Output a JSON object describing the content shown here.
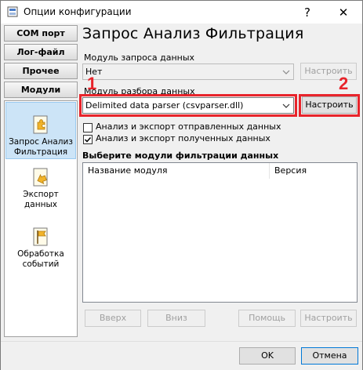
{
  "window": {
    "title": "Опции конфигурации",
    "help_glyph": "?",
    "close_glyph": "✕"
  },
  "nav": {
    "buttons": [
      "COM порт",
      "Лог-файл",
      "Прочее",
      "Модули"
    ]
  },
  "sidebar": {
    "items": [
      {
        "label": "Запрос Анализ Фильтрация",
        "icon": "puzzle-icon",
        "active": true
      },
      {
        "label": "Экспорт данных",
        "icon": "export-icon",
        "active": false
      },
      {
        "label": "Обработка событий",
        "icon": "flag-icon",
        "active": false
      }
    ]
  },
  "main": {
    "header": "Запрос Анализ Фильтрация",
    "query_module": {
      "label": "Модуль запроса данных",
      "value": "Нет",
      "configure_label": "Настроить"
    },
    "parser_module": {
      "label": "Модуль разбора данных",
      "value": "Delimited data parser (csvparser.dll)",
      "configure_label": "Настроить"
    },
    "checkboxes": [
      {
        "label": "Анализ и экспорт отправленных данных",
        "checked": false
      },
      {
        "label": "Анализ и экспорт полученных данных",
        "checked": true
      }
    ],
    "filter_section": {
      "label": "Выберите модули фильтрации данных",
      "columns": [
        "Название модуля",
        "Версия"
      ]
    },
    "filter_buttons": {
      "up": "Вверх",
      "down": "Вниз",
      "help": "Помощь",
      "configure": "Настроить"
    }
  },
  "footer": {
    "ok": "OK",
    "cancel": "Отмена"
  },
  "annotations": {
    "marker_1": "1",
    "marker_2": "2",
    "color": "#e8242b"
  }
}
